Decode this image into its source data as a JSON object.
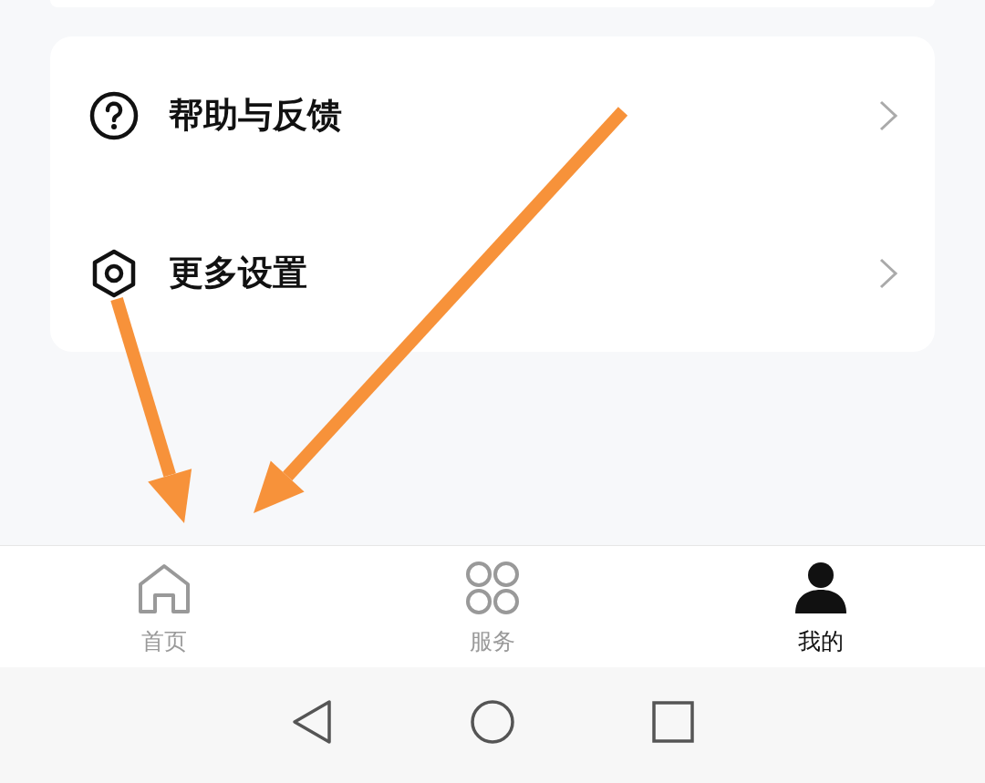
{
  "menu_items": [
    {
      "kind": "help",
      "label": "帮助与反馈"
    },
    {
      "kind": "settings",
      "label": "更多设置"
    }
  ],
  "tabs": [
    {
      "kind": "home",
      "label": "首页",
      "selected": false
    },
    {
      "kind": "services",
      "label": "服务",
      "selected": false
    },
    {
      "kind": "profile",
      "label": "我的",
      "selected": true
    }
  ],
  "nav_buttons": [
    {
      "kind": "back"
    },
    {
      "kind": "home"
    },
    {
      "kind": "recents"
    }
  ]
}
